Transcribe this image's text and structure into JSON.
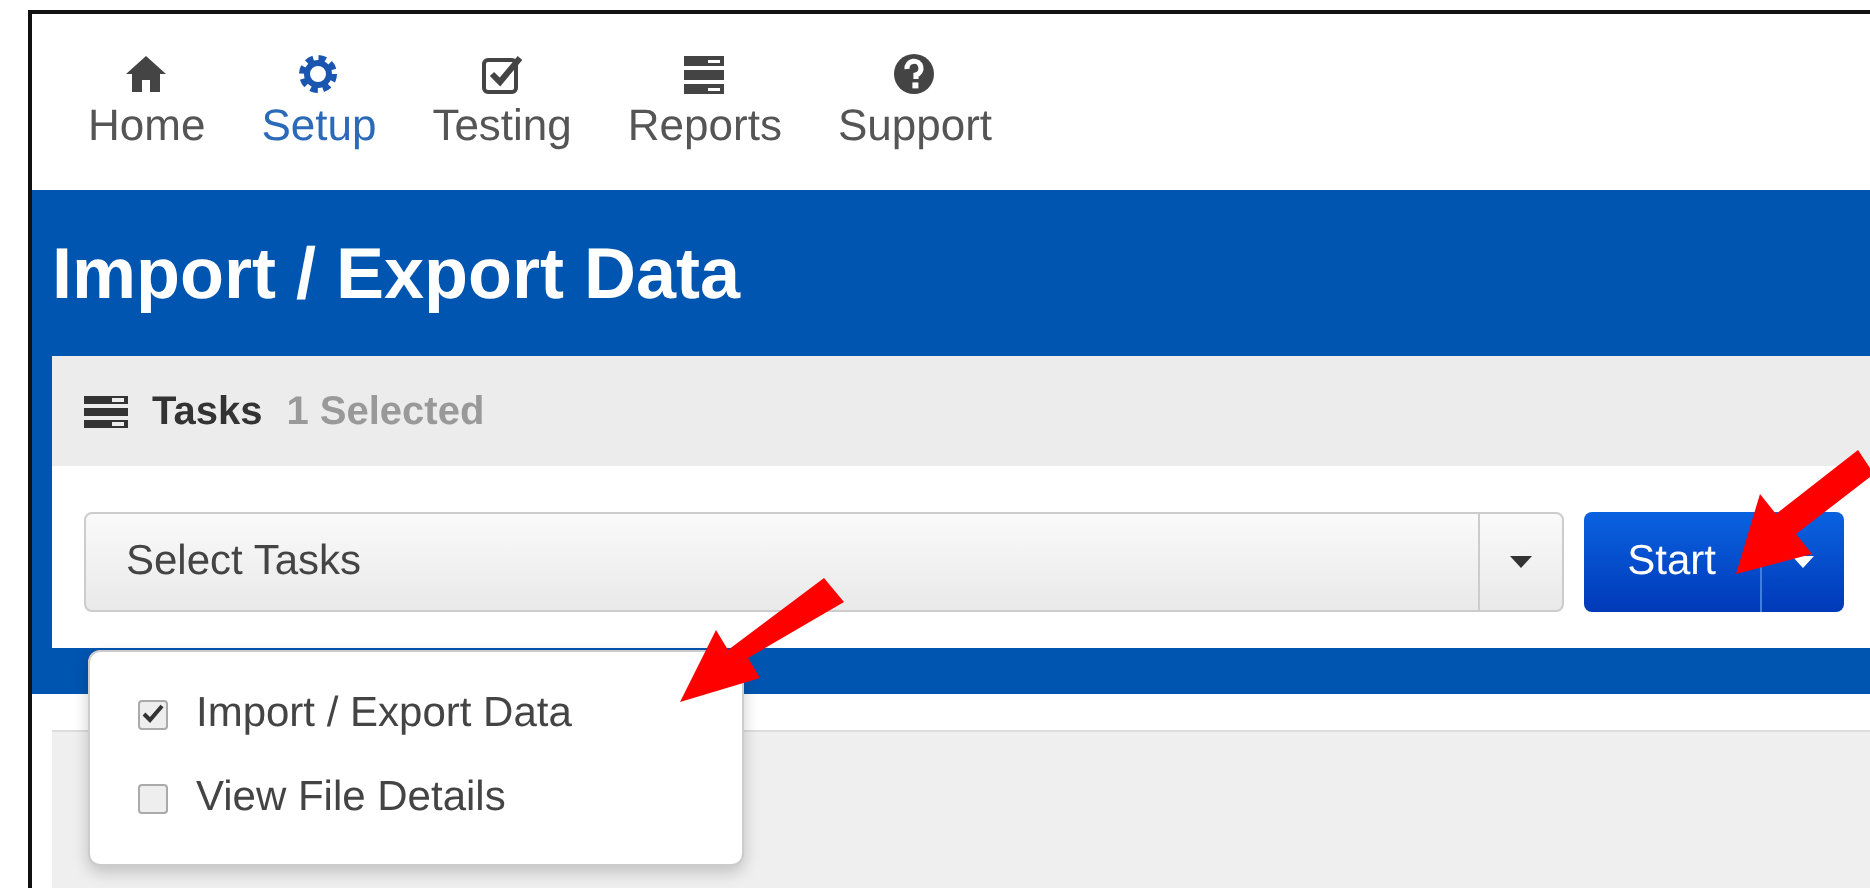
{
  "nav": [
    {
      "label": "Home",
      "selected": false
    },
    {
      "label": "Setup",
      "selected": true
    },
    {
      "label": "Testing",
      "selected": false
    },
    {
      "label": "Reports",
      "selected": false
    },
    {
      "label": "Support",
      "selected": false
    }
  ],
  "page_title": "Import / Export Data",
  "tasks_panel": {
    "title": "Tasks",
    "selected_count": "1 Selected",
    "select_placeholder": "Select Tasks",
    "start_button": "Start",
    "options": [
      {
        "label": "Import / Export Data",
        "checked": true
      },
      {
        "label": "View File Details",
        "checked": false
      }
    ]
  }
}
